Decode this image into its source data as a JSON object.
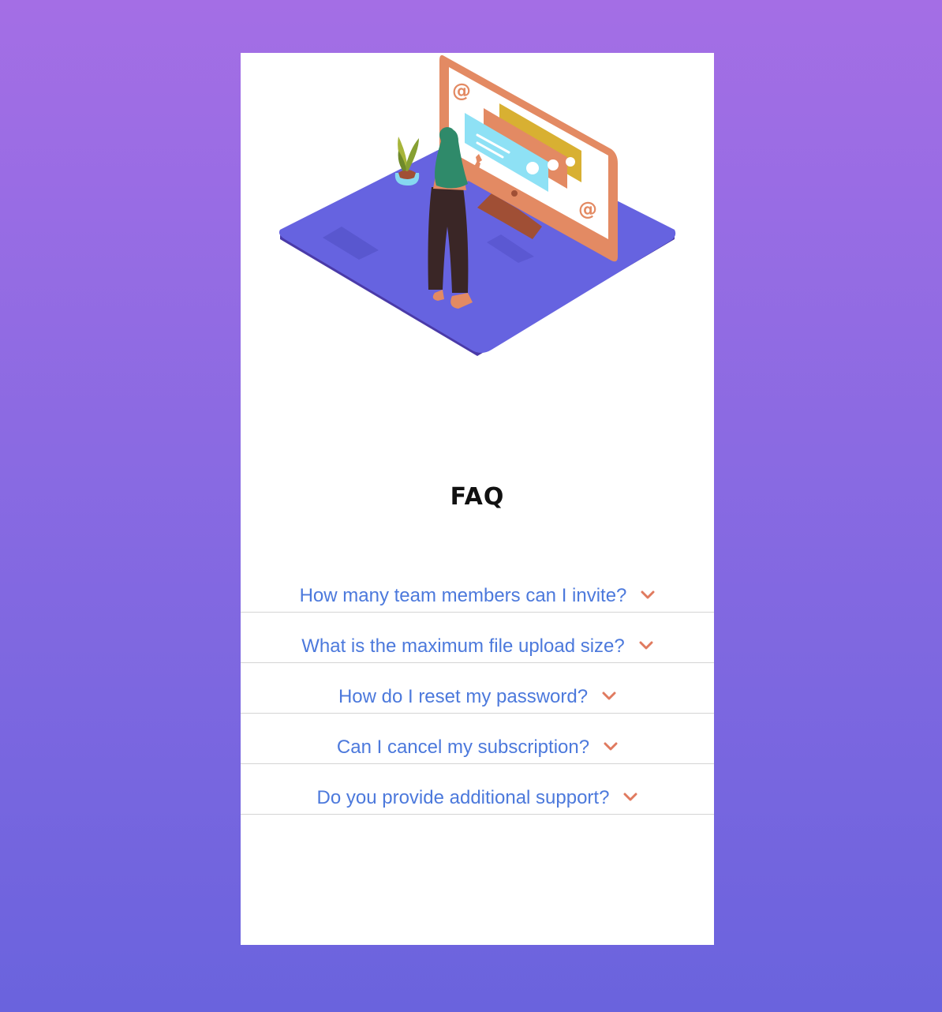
{
  "faq": {
    "title": "FAQ",
    "items": [
      {
        "question": "How many team members can I invite?"
      },
      {
        "question": "What is the maximum file upload size?"
      },
      {
        "question": "How do I reset my password?"
      },
      {
        "question": "Can I cancel my subscription?"
      },
      {
        "question": "Do you provide additional support?"
      }
    ]
  },
  "illustration": {
    "at_symbol": "@"
  },
  "colors": {
    "question_text": "#4c79dc",
    "chevron": "#e07a5f",
    "background_top": "#a46ee5",
    "background_bottom": "#6a63dd",
    "platform": "#6663e0"
  },
  "icons": {
    "chevron": "chevron-down-icon"
  }
}
